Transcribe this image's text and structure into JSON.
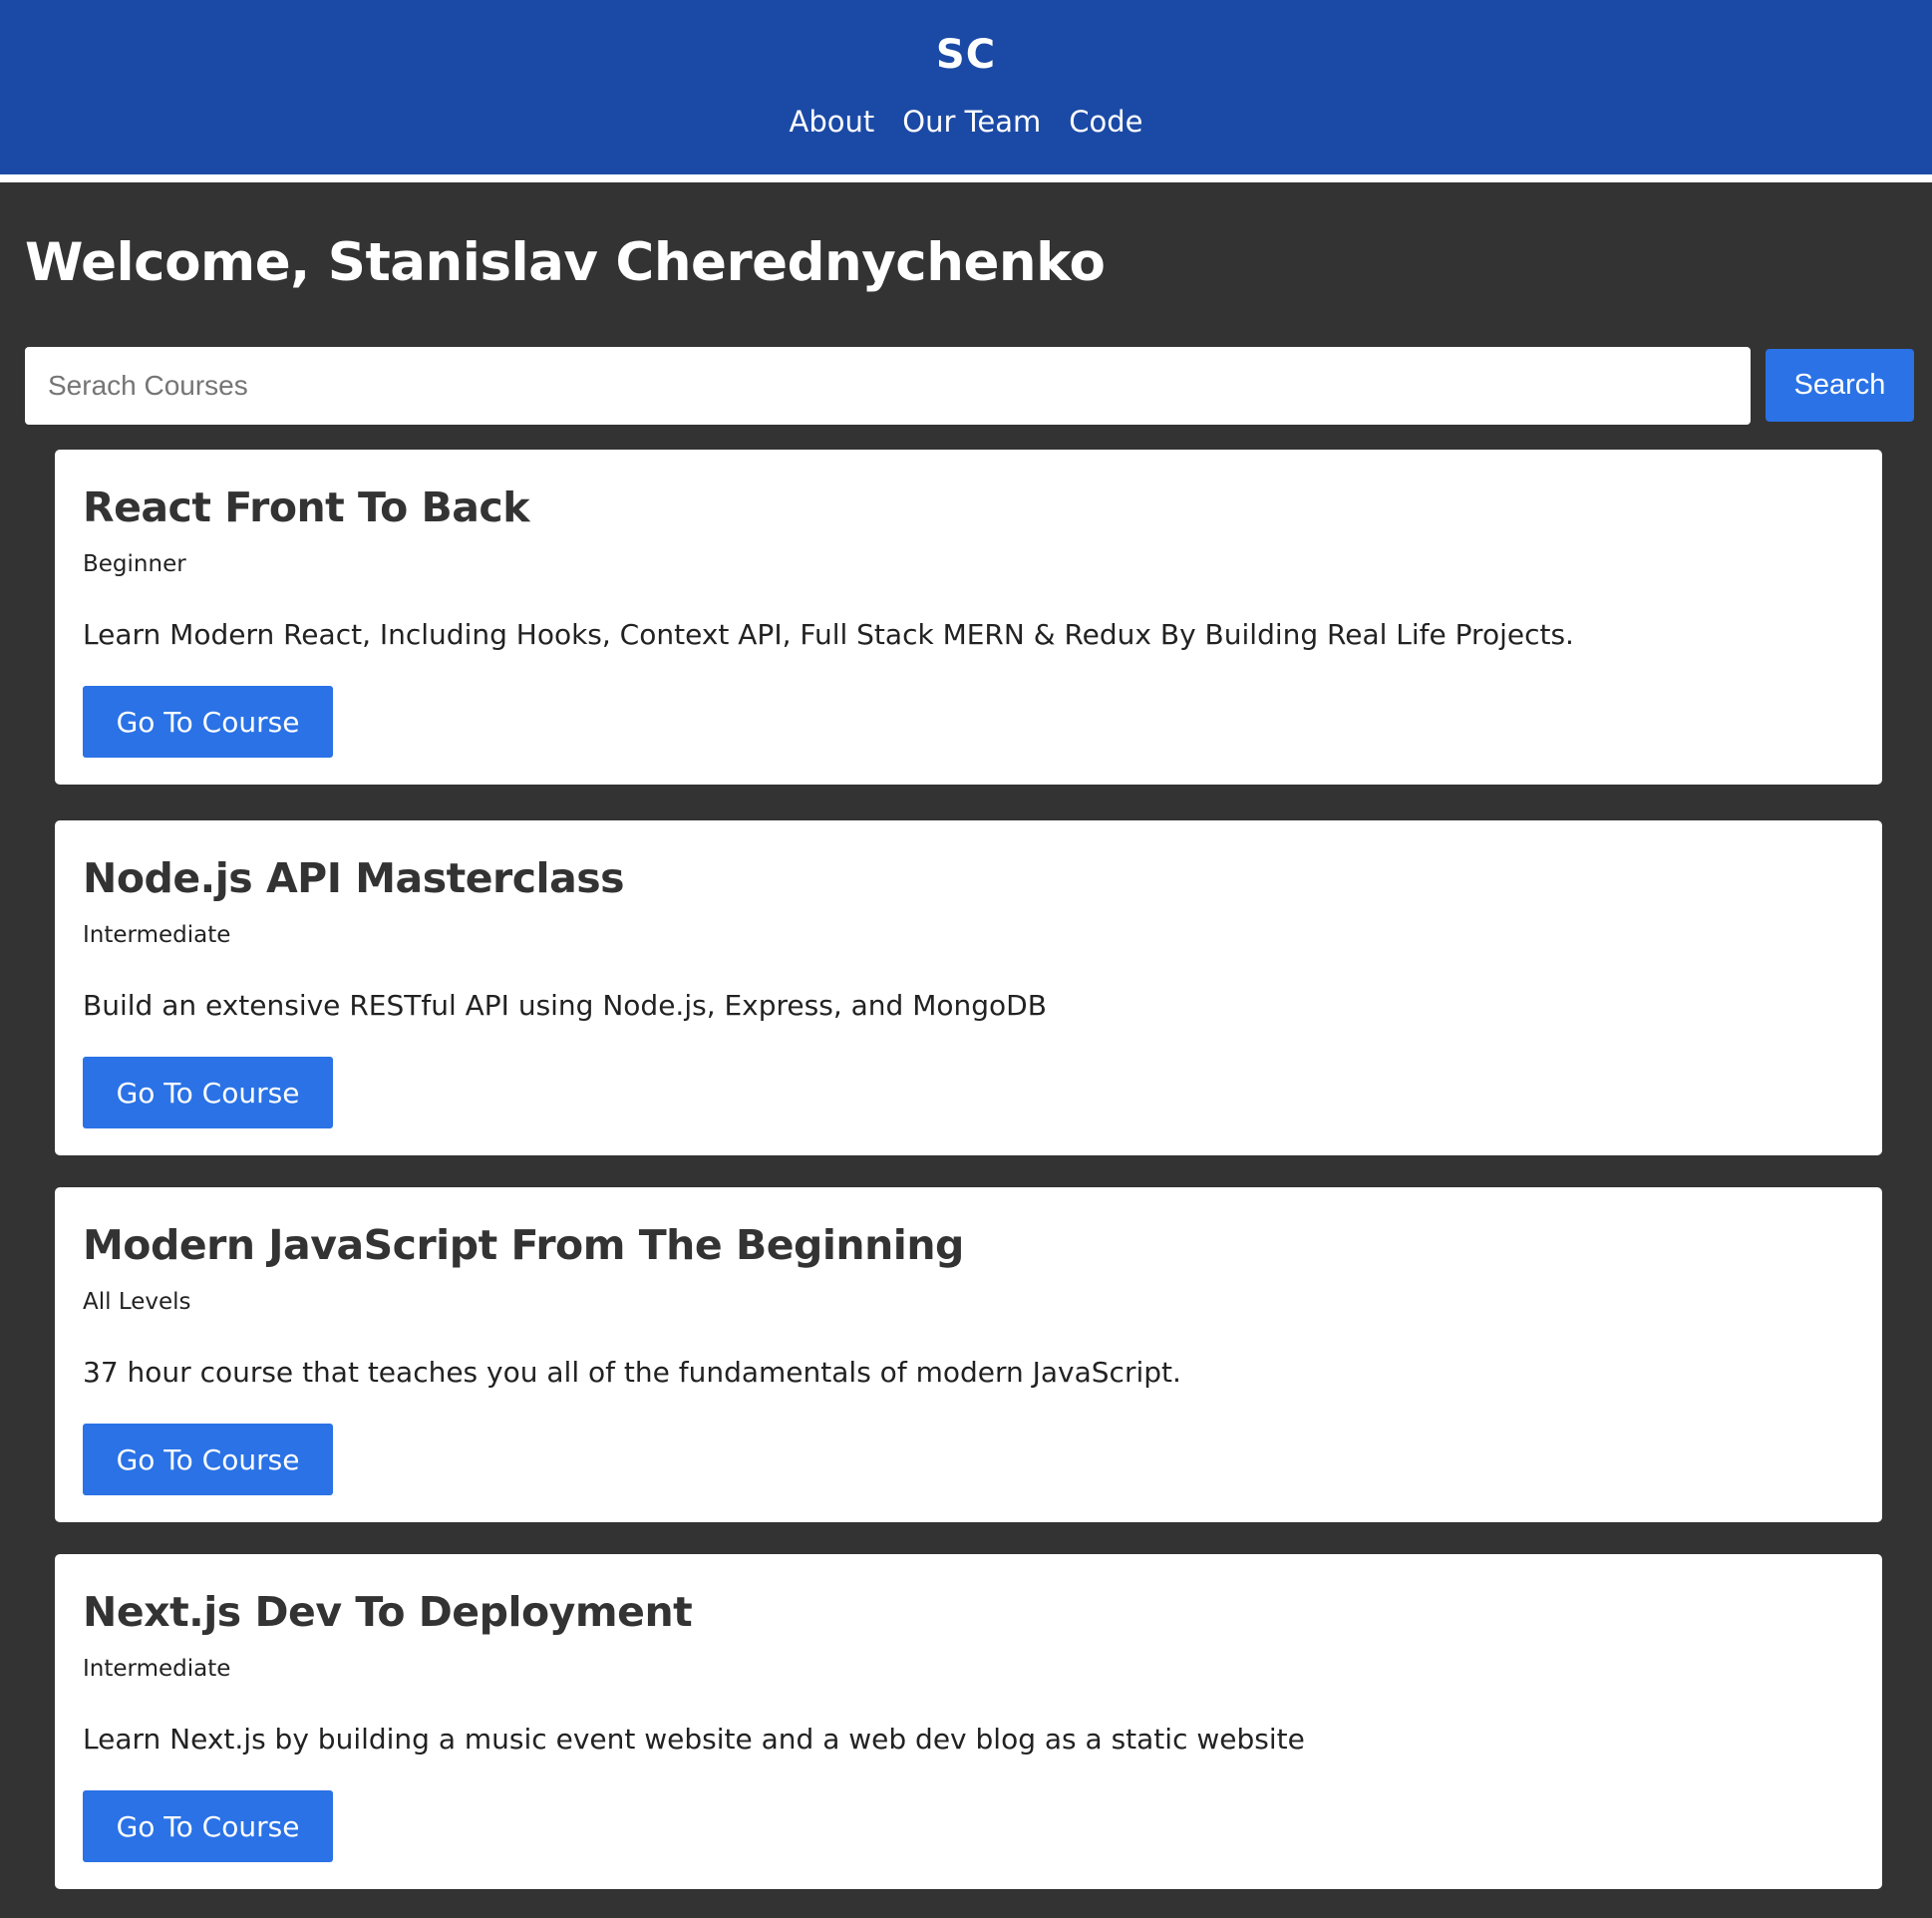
{
  "header": {
    "logo": "SC",
    "nav": [
      {
        "label": "About"
      },
      {
        "label": "Our Team"
      },
      {
        "label": "Code"
      }
    ]
  },
  "main": {
    "welcome": "Welcome, Stanislav Cherednychenko",
    "search": {
      "placeholder": "Serach Courses",
      "value": "",
      "button_label": "Search"
    },
    "courses": [
      {
        "title": "React Front To Back",
        "level": "Beginner",
        "description": "Learn Modern React, Including Hooks, Context API, Full Stack MERN & Redux By Building Real Life Projects.",
        "button_label": "Go To Course"
      },
      {
        "title": "Node.js API Masterclass",
        "level": "Intermediate",
        "description": "Build an extensive RESTful API using Node.js, Express, and MongoDB",
        "button_label": "Go To Course"
      },
      {
        "title": "Modern JavaScript From The Beginning",
        "level": "All Levels",
        "description": "37 hour course that teaches you all of the fundamentals of modern JavaScript.",
        "button_label": "Go To Course"
      },
      {
        "title": "Next.js Dev To Deployment",
        "level": "Intermediate",
        "description": "Learn Next.js by building a music event website and a web dev blog as a static website",
        "button_label": "Go To Course"
      }
    ]
  },
  "colors": {
    "header_bg": "#1b4aa6",
    "page_bg": "#333333",
    "accent": "#2a72e6",
    "card_bg": "#ffffff"
  }
}
